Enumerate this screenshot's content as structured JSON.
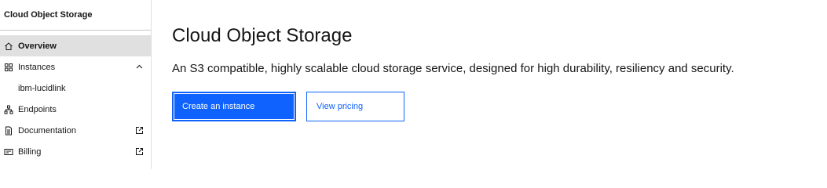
{
  "sidebar": {
    "title": "Cloud Object Storage",
    "items": [
      {
        "label": "Overview",
        "icon": "home-icon"
      },
      {
        "label": "Instances",
        "icon": "grid-icon",
        "trail": "chevron-up-icon"
      },
      {
        "label": "ibm-lucidlink"
      },
      {
        "label": "Endpoints",
        "icon": "network-icon"
      },
      {
        "label": "Documentation",
        "icon": "document-icon",
        "trail": "launch-icon"
      },
      {
        "label": "Billing",
        "icon": "billing-icon",
        "trail": "launch-icon"
      }
    ]
  },
  "main": {
    "title": "Cloud Object Storage",
    "description": "An S3 compatible, highly scalable cloud storage service, designed for high durability, resiliency and security.",
    "primary_button": "Create an instance",
    "secondary_button": "View pricing"
  },
  "colors": {
    "accent": "#0f62fe",
    "active_bg": "#e0e0e0",
    "text": "#161616"
  }
}
